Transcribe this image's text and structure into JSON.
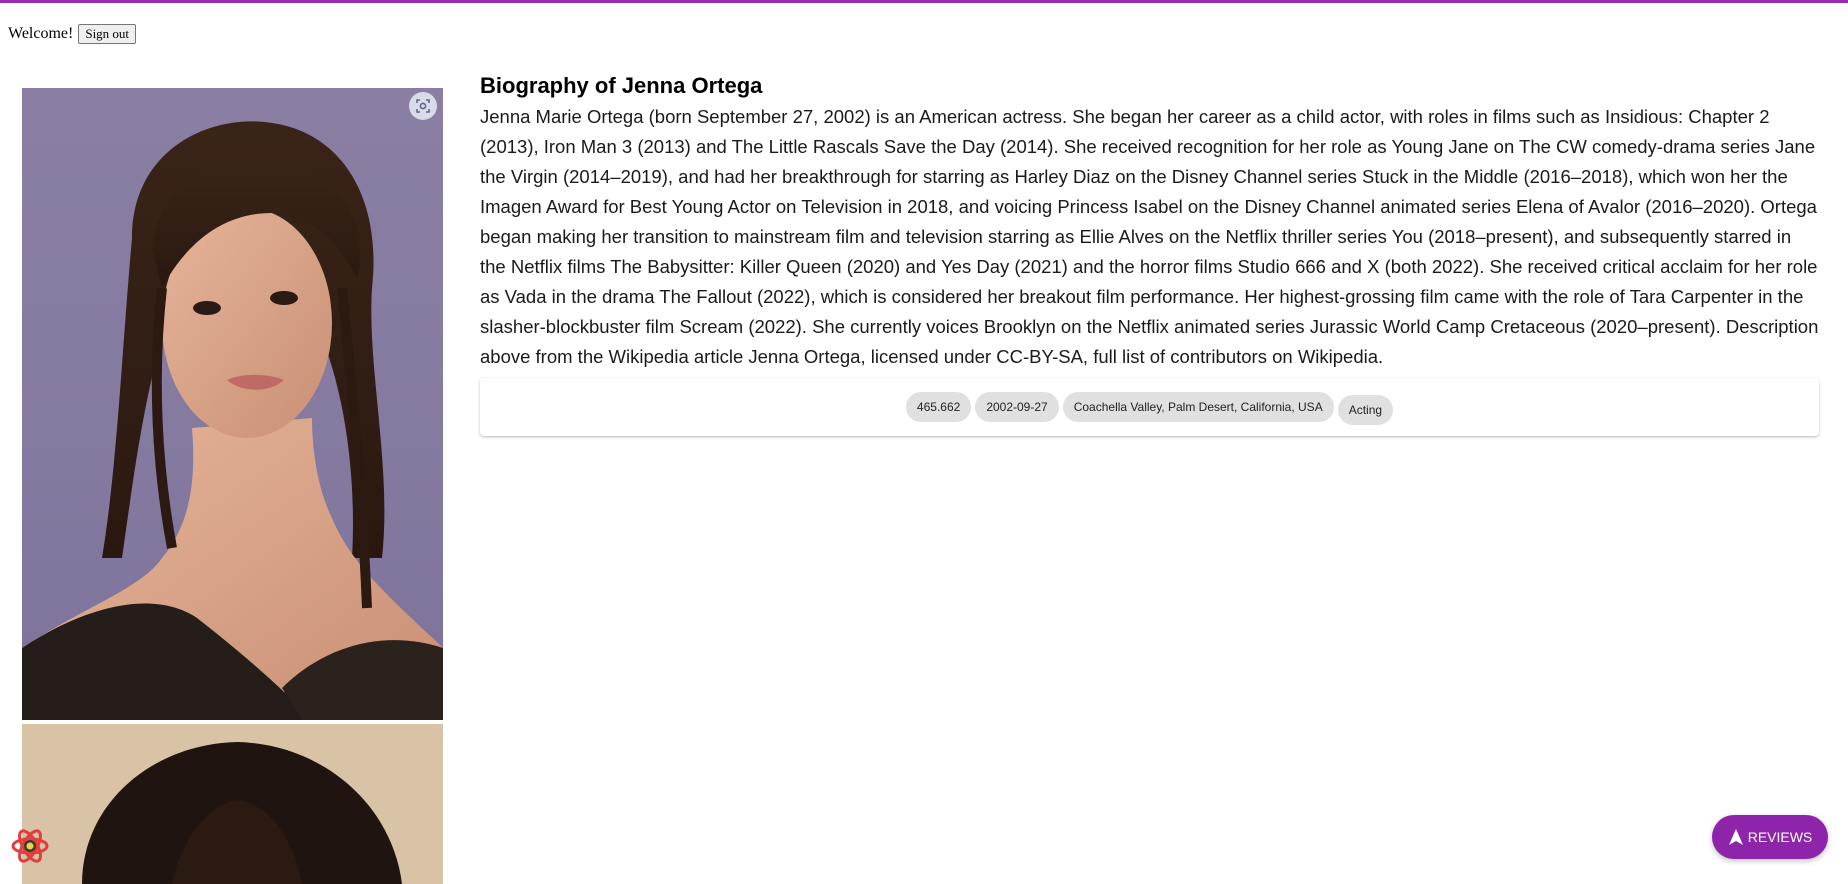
{
  "auth": {
    "welcome": "Welcome!",
    "sign_out_label": "Sign out"
  },
  "biography": {
    "title": "Biography of Jenna Ortega",
    "text": "Jenna Marie Ortega (born September 27, 2002) is an American actress. She began her career as a child actor, with roles in films such as Insidious: Chapter 2 (2013), Iron Man 3 (2013) and The Little Rascals Save the Day (2014). She received recognition for her role as Young Jane on The CW comedy-drama series Jane the Virgin (2014–2019), and had her breakthrough for starring as Harley Diaz on the Disney Channel series Stuck in the Middle (2016–2018), which won her the Imagen Award for Best Young Actor on Television in 2018, and voicing Princess Isabel on the Disney Channel animated series Elena of Avalor (2016–2020). Ortega began making her transition to mainstream film and television starring as Ellie Alves on the Netflix thriller series You (2018–present), and subsequently starred in the Netflix films The Babysitter: Killer Queen (2020) and Yes Day (2021) and the horror films Studio 666 and X (both 2022). She received critical acclaim for her role as Vada in the drama The Fallout (2022), which is considered her breakout film performance. Her highest-grossing film came with the role of Tara Carpenter in the slasher-blockbuster film Scream (2022). She currently voices Brooklyn on the Netflix animated series Jurassic World Camp Cretaceous (2020–present). Description above from the Wikipedia article Jenna Ortega, licensed under CC-BY-SA, full list of contributors on Wikipedia."
  },
  "chips": {
    "popularity": "465.662",
    "birthday": "2002-09-27",
    "place_of_birth": "Coachella Valley, Palm Desert, California, USA",
    "department": "Acting"
  },
  "reviews_button": {
    "label": "REVIEWS",
    "icon": "navigation-arrow-icon"
  },
  "colors": {
    "accent": "#9c27b0",
    "reviews_bg": "#8e24aa",
    "chip_bg": "#e0e0e0"
  }
}
